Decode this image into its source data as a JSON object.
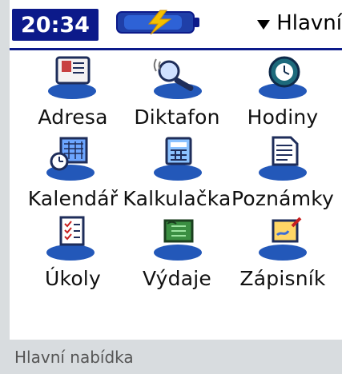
{
  "status": {
    "time": "20:34",
    "menu_title": "Hlavní"
  },
  "apps": [
    {
      "label": "Adresa",
      "icon": "address-book-icon"
    },
    {
      "label": "Diktafon",
      "icon": "dictaphone-icon"
    },
    {
      "label": "Hodiny",
      "icon": "clock-icon"
    },
    {
      "label": "Kalendář",
      "icon": "calendar-icon"
    },
    {
      "label": "Kalkulačka",
      "icon": "calculator-icon"
    },
    {
      "label": "Poznámky",
      "icon": "notes-icon"
    },
    {
      "label": "Úkoly",
      "icon": "tasks-icon"
    },
    {
      "label": "Výdaje",
      "icon": "expenses-icon"
    },
    {
      "label": "Zápisník",
      "icon": "notepad-icon"
    }
  ],
  "caption": "Hlavní nabídka",
  "colors": {
    "accent": "#0c1a8a",
    "icon_blue": "#1f4fa6"
  }
}
